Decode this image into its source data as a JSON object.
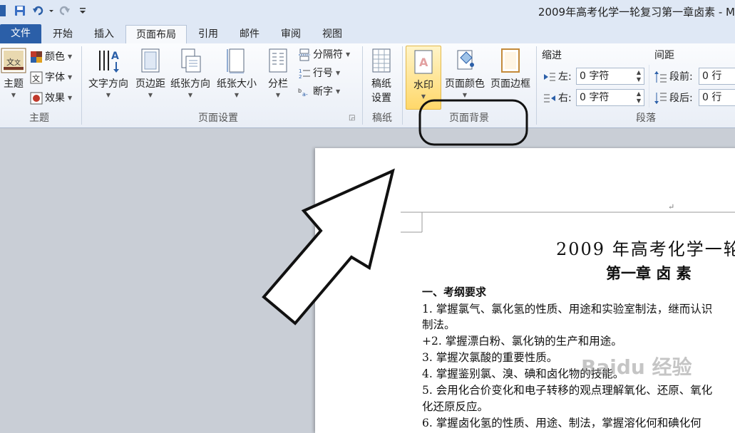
{
  "titlebar": {
    "title": "2009年高考化学一轮复习第一章卤素 - M"
  },
  "tabs": [
    {
      "label": "文件"
    },
    {
      "label": "开始"
    },
    {
      "label": "插入"
    },
    {
      "label": "页面布局"
    },
    {
      "label": "引用"
    },
    {
      "label": "邮件"
    },
    {
      "label": "审阅"
    },
    {
      "label": "视图"
    }
  ],
  "ribbon": {
    "theme": {
      "big": "主题",
      "colors": "颜色",
      "fonts": "字体",
      "effects": "效果",
      "group": "主题"
    },
    "page_setup": {
      "text_direction": "文字方向",
      "margins": "页边距",
      "orientation": "纸张方向",
      "size": "纸张大小",
      "columns": "分栏",
      "breaks": "分隔符",
      "line_numbers": "行号",
      "hyphenation": "断字",
      "group": "页面设置"
    },
    "manuscript": {
      "line1": "稿纸",
      "line2": "设置",
      "group": "稿纸"
    },
    "page_background": {
      "watermark": "水印",
      "page_color": "页面颜色",
      "page_borders": "页面边框",
      "group": "页面背景"
    },
    "paragraph": {
      "indent_title": "缩进",
      "spacing_title": "间距",
      "left_label": "左:",
      "left_value": "0 字符",
      "right_label": "右:",
      "right_value": "0 字符",
      "before_label": "段前:",
      "before_value": "0 行",
      "after_label": "段后:",
      "after_value": "0 行",
      "group": "段落"
    }
  },
  "document": {
    "title": "2009 年高考化学一轮",
    "chapter": "第一章   卤  素",
    "section": "一、考纲要求",
    "lines": [
      "1. 掌握氯气、氯化氢的性质、用途和实验室制法，继而认识",
      "制法。",
      "+2. 掌握漂白粉、氯化钠的生产和用途。",
      "3. 掌握次氯酸的重要性质。",
      "4. 掌握鉴别氯、溴、碘和卤化物的技能。",
      "5. 会用化合价变化和电子转移的观点理解氧化、还原、氧化",
      "化还原反应。",
      "6. 掌握卤化氢的性质、用途、制法，掌握溶化何和碘化何"
    ]
  },
  "colors": {
    "file_tab": "#2b5fa8",
    "ribbon_bg": "#f7f9fc",
    "workspace": "#c9ced6",
    "watermark_highlight": "#ffd86a"
  }
}
